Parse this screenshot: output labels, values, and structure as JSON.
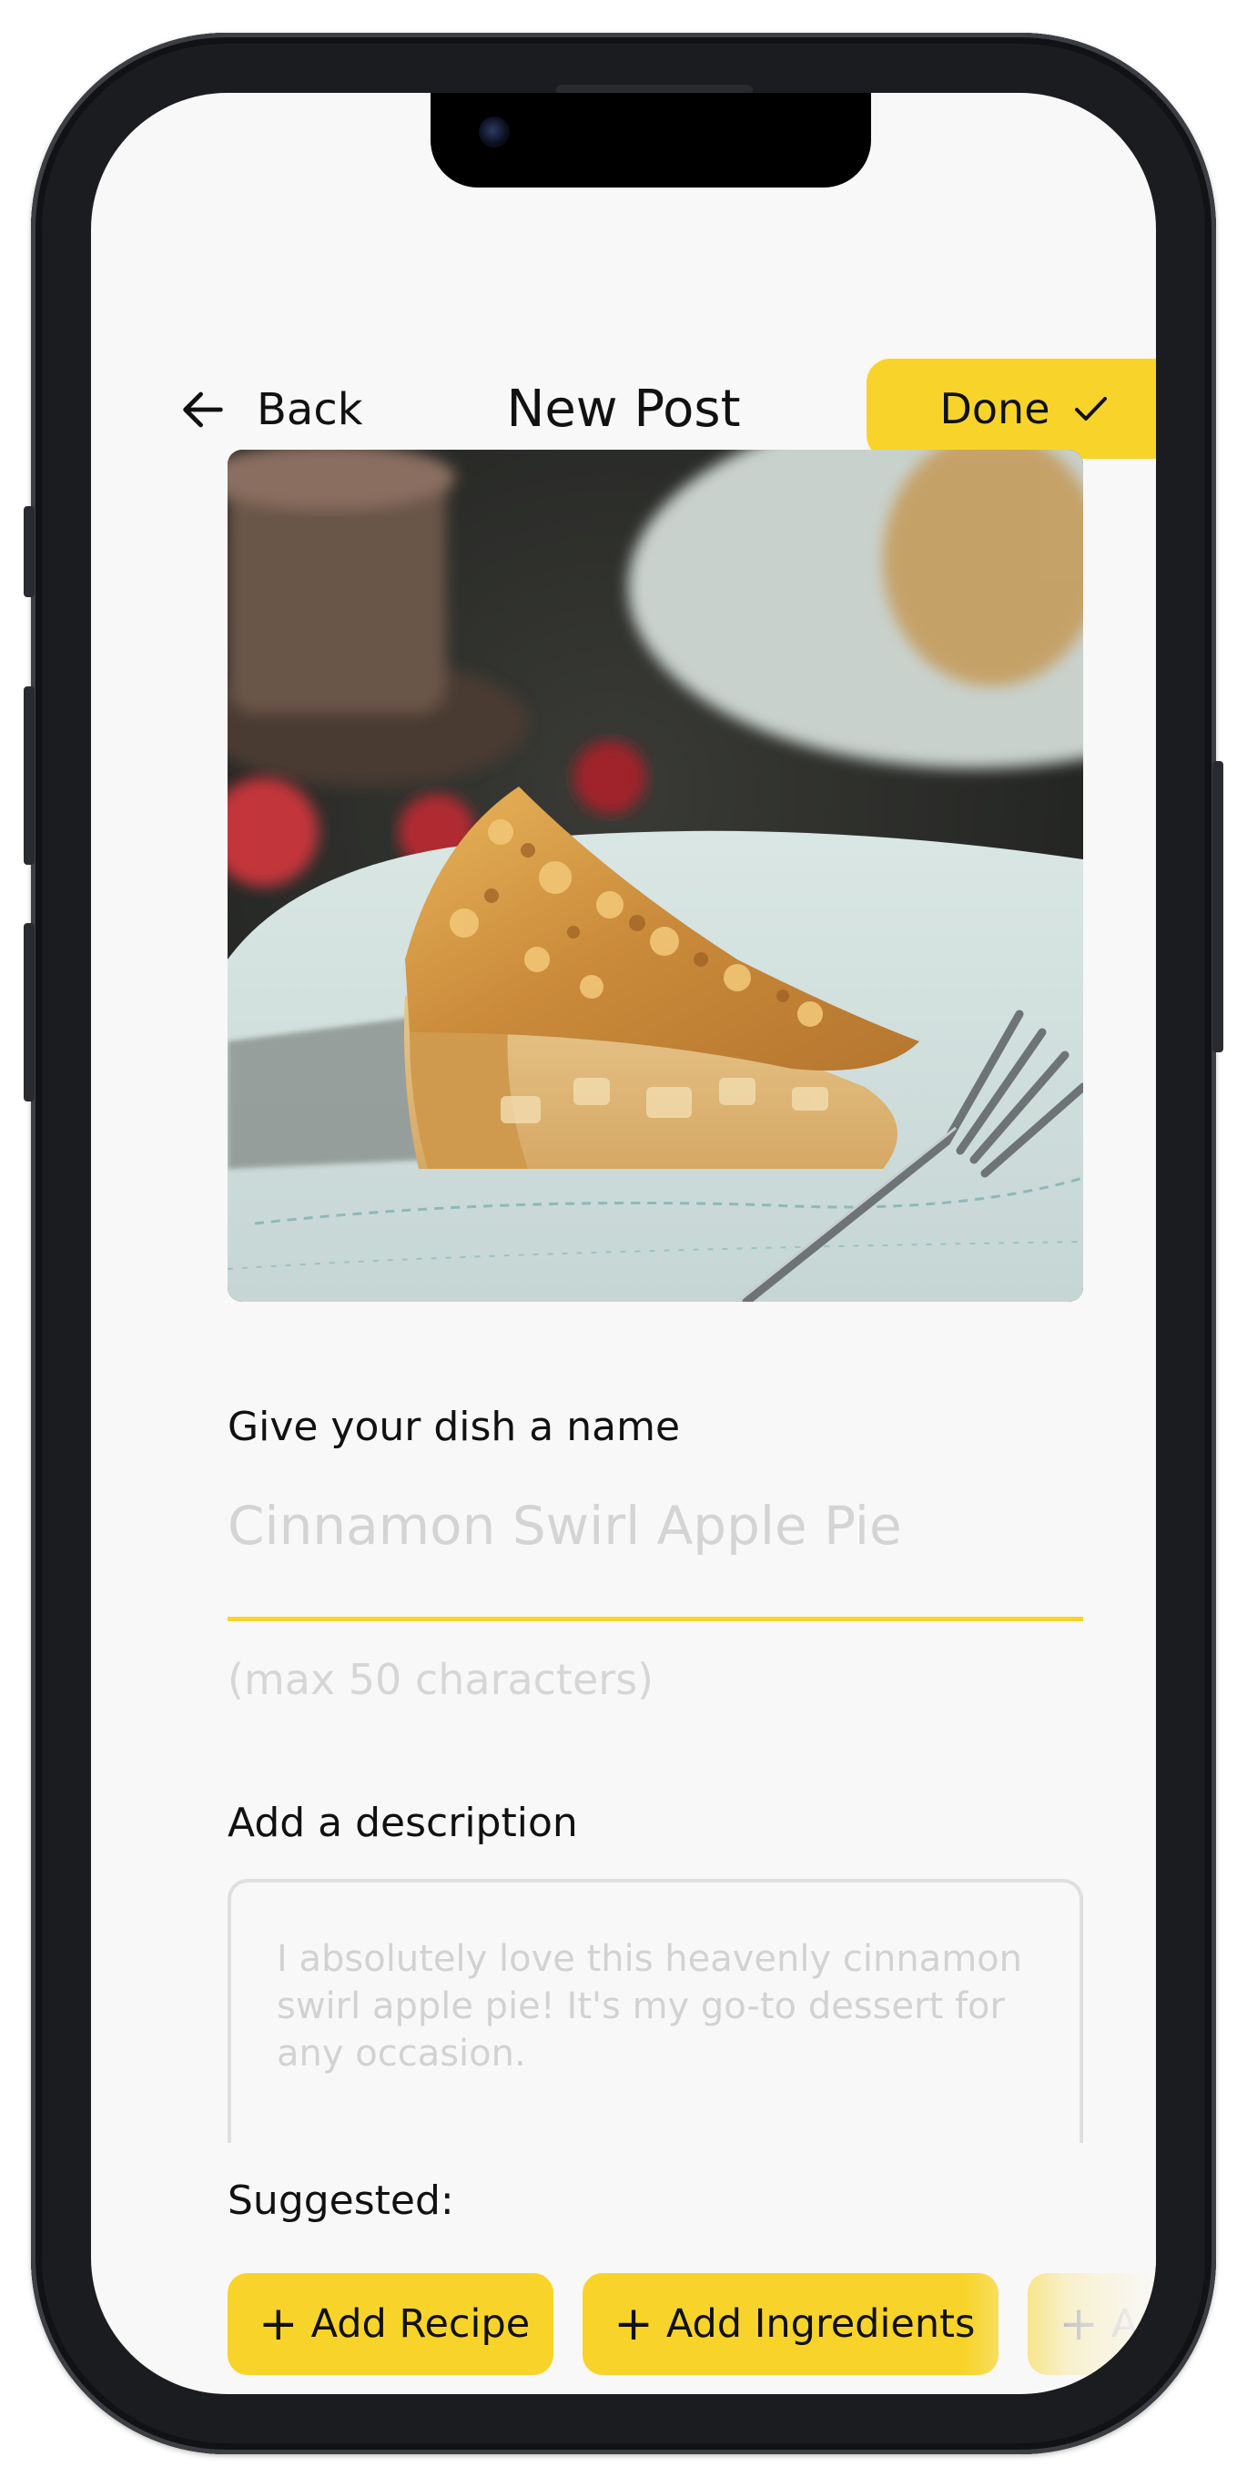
{
  "header": {
    "back_label": "Back",
    "title": "New Post",
    "done_label": "Done"
  },
  "photo": {
    "subject": "slice of apple pie on a plate with a fork"
  },
  "form": {
    "name_label": "Give your dish a name",
    "name_placeholder": "Cinnamon Swirl Apple Pie",
    "name_hint": "(max 50 characters)",
    "description_label": "Add a description",
    "description_placeholder": "I absolutely love this heavenly cinnamon swirl apple pie! It's my go-to dessert for any occasion."
  },
  "suggested": {
    "label": "Suggested:",
    "chips": [
      {
        "label": "Add Recipe"
      },
      {
        "label": "Add Ingredients"
      },
      {
        "label": "Add P"
      }
    ]
  },
  "colors": {
    "accent": "#f8d42a",
    "background": "#f8f8f8",
    "text": "#111111",
    "placeholder": "#d4d4d4"
  },
  "icons": {
    "back": "arrow-left-icon",
    "done": "checkmark-icon",
    "chip": "plus-icon"
  }
}
